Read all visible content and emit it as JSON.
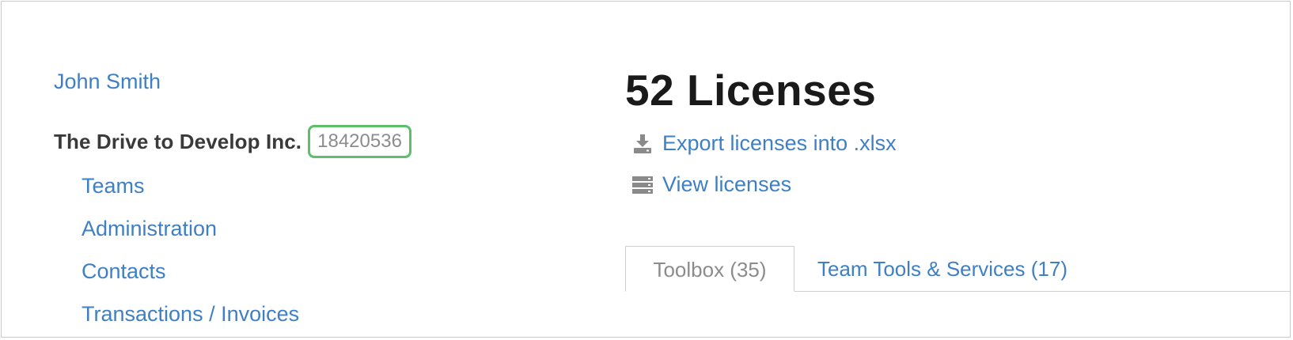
{
  "user": {
    "name": "John Smith"
  },
  "organization": {
    "name": "The Drive to Develop Inc.",
    "id": "18420536"
  },
  "sub_nav": {
    "items": [
      {
        "label": "Teams"
      },
      {
        "label": "Administration"
      },
      {
        "label": "Contacts"
      },
      {
        "label": "Transactions / Invoices"
      }
    ]
  },
  "licenses": {
    "title": "52 Licenses",
    "export_label": "Export licenses into .xlsx",
    "export_icon": "download-icon",
    "view_label": "View licenses",
    "view_icon": "list-icon"
  },
  "tabs": [
    {
      "label": "Toolbox (35)",
      "active": true
    },
    {
      "label": "Team Tools & Services (17)",
      "active": false
    }
  ],
  "colors": {
    "link": "#3f7fc4",
    "id_badge_border": "#5cbf6a",
    "muted_text": "#8c8c8c",
    "heading": "#1a1a1a"
  }
}
